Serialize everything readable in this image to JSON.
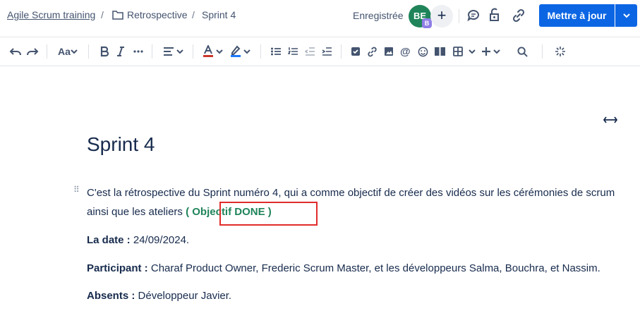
{
  "breadcrumb": {
    "space": "Agile Scrum training",
    "folder": "Retrospective",
    "current": "Sprint 4",
    "separator": "/"
  },
  "header": {
    "status": "Enregistrée",
    "avatar_initials": "BE",
    "avatar_badge": "B",
    "publish_label": "Mettre à jour"
  },
  "toolbar": {
    "text_style": "Aa"
  },
  "page": {
    "title": "Sprint 4",
    "intro_text": "C'est la rétrospective du Sprint numéro 4, qui a comme objectif de créer des vidéos sur les cérémonies de scrum ainsi que les ateliers",
    "status_label": "( Objectif DONE )",
    "date_label": "La date :",
    "date_value": "24/09/2024.",
    "participants_label": "Participant :",
    "participants_value": "Charaf Product Owner, Frederic Scrum Master, et les développeurs Salma, Bouchra, et Nassim.",
    "absents_label": "Absents :",
    "absents_value": "Développeur Javier."
  },
  "colors": {
    "accent": "#0c66e4",
    "done": "#1f845a",
    "avatar": "#1f845a",
    "highlight": "#e12b2b"
  }
}
